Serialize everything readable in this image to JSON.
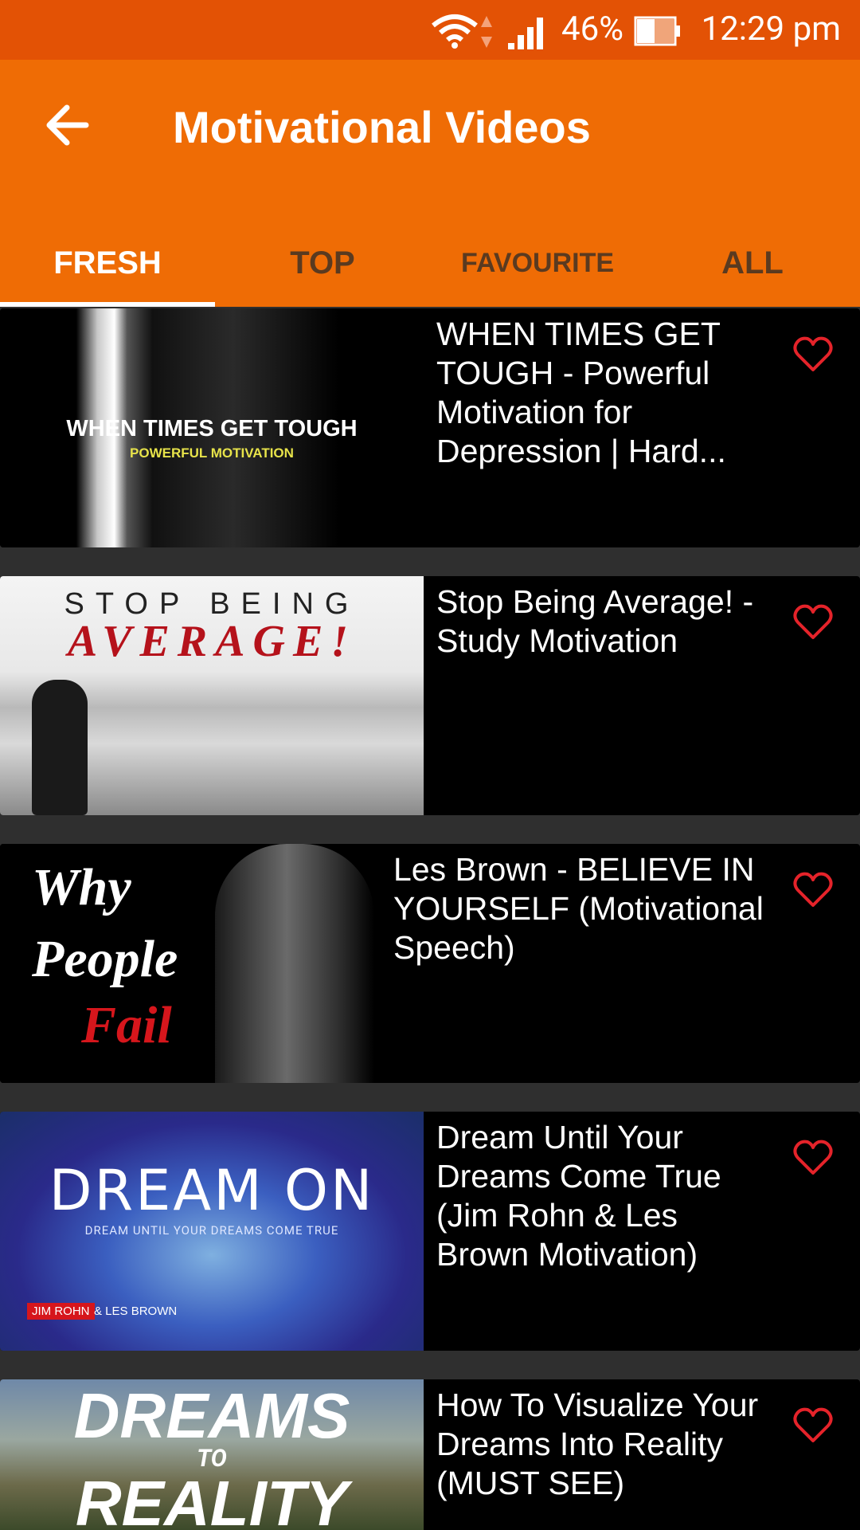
{
  "status_bar": {
    "battery_percent": "46%",
    "time": "12:29 pm",
    "icons": [
      "wifi-icon",
      "signal-icon",
      "battery-icon"
    ]
  },
  "app_bar": {
    "title": "Motivational Videos",
    "back_icon": "back-arrow-icon"
  },
  "tabs": [
    {
      "label": "FRESH",
      "active": true
    },
    {
      "label": "TOP",
      "active": false
    },
    {
      "label": "FAVOURITE",
      "active": false
    },
    {
      "label": "ALL",
      "active": false
    }
  ],
  "colors": {
    "status_bar": "#e35205",
    "app_bar": "#ef6c05",
    "heart": "#e5232a",
    "list_bg": "#2f2f2f",
    "card_bg": "#000000"
  },
  "videos": [
    {
      "title": "WHEN TIMES GET TOUGH - Powerful Motivation for Depression | Hard...",
      "thumb_text": "WHEN TIMES GET TOUGH",
      "thumb_subtext": "POWERFUL MOTIVATION"
    },
    {
      "title": "Stop Being Average! - Study Motivation",
      "thumb_text": "STOP BEING",
      "thumb_subtext": "AVERAGE!"
    },
    {
      "title": "Les Brown - BELIEVE IN YOURSELF (Motivational Speech)",
      "thumb_text": "Why People",
      "thumb_subtext": "Fail"
    },
    {
      "title": "Dream Until Your Dreams Come True (Jim Rohn & Les Brown Motivation)",
      "thumb_text": "DREAM ON",
      "thumb_subtext": "DREAM UNTIL YOUR DREAMS COME TRUE",
      "thumb_badge": "JIM ROHN",
      "thumb_badge2": "& LES BROWN"
    },
    {
      "title": "How To Visualize Your Dreams Into Reality (MUST SEE)",
      "thumb_text": "DREAMS",
      "thumb_subtext": "REALITY",
      "thumb_mid": "TO"
    }
  ]
}
